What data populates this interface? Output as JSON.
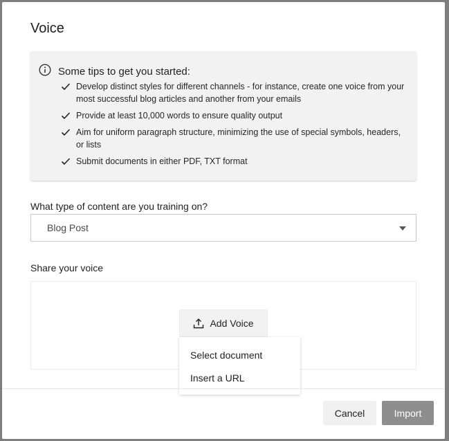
{
  "modal": {
    "title": "Voice"
  },
  "tips": {
    "icon": "info-icon",
    "title": "Some tips to get you started:",
    "items": [
      "Develop distinct styles for different channels - for instance, create one voice from your most successful blog articles and another from your emails",
      "Provide at least 10,000 words to ensure quality output",
      "Aim for uniform paragraph structure, minimizing the use of special symbols, headers, or lists",
      "Submit documents in either PDF, TXT format"
    ]
  },
  "content_type": {
    "label": "What type of content are you training on?",
    "selected": "Blog Post"
  },
  "share": {
    "label": "Share your voice",
    "add_voice_label": "Add Voice",
    "menu": [
      "Select document",
      "Insert a URL"
    ]
  },
  "footer": {
    "cancel_label": "Cancel",
    "import_label": "Import"
  },
  "colors": {
    "backdrop": "#7f7f7f",
    "tips_bg": "#f2f2f2",
    "import_bg": "#8e8e8e",
    "cancel_bg": "#f0f0f0"
  }
}
